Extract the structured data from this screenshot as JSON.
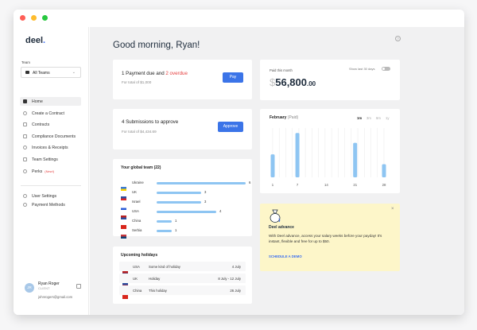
{
  "brand": {
    "logo_text": "deel",
    "logo_dot": "."
  },
  "sidebar": {
    "team_label": "Team",
    "team_value": "All Teams",
    "items": [
      {
        "label": "Home",
        "active": true
      },
      {
        "label": "Create a Contract"
      },
      {
        "label": "Contracts"
      },
      {
        "label": "Compliance Documents"
      },
      {
        "label": "Invoices & Receipts"
      },
      {
        "label": "Team Settings"
      },
      {
        "label": "Perks",
        "badge": "(New!)"
      }
    ],
    "bottom_items": [
      {
        "label": "User Settings"
      },
      {
        "label": "Payment Methods"
      }
    ],
    "user": {
      "initials": "JR",
      "name": "Ryan Roger",
      "role": "CLIENT",
      "email": "johnrogers@gmail.com"
    }
  },
  "main": {
    "greeting": "Good morning, Ryan!",
    "help": "?",
    "payment_card": {
      "title_a": "1 Payment due and ",
      "title_b": "2 overdue",
      "total": "For total of $1,000",
      "button": "Pay"
    },
    "submission_card": {
      "title": "4 Submissions to approve",
      "total": "For total of $4,434.69",
      "button": "Approve"
    },
    "team_card": {
      "title": "Your global team (22)",
      "rows": [
        {
          "country": "Ukraine",
          "count": "6",
          "value": 6
        },
        {
          "country": "UK",
          "count": "3",
          "value": 3
        },
        {
          "country": "Israel",
          "count": "3",
          "value": 3
        },
        {
          "country": "USA",
          "count": "4",
          "value": 4
        },
        {
          "country": "China",
          "count": "1",
          "value": 1
        },
        {
          "country": "Serbia",
          "count": "1",
          "value": 1
        }
      ]
    },
    "holidays_card": {
      "title": "Upcoming holidays",
      "rows": [
        {
          "country": "USA",
          "name": "Some kind of holiday",
          "date": "4 July"
        },
        {
          "country": "UK",
          "name": "Holiday",
          "date": "8 July - 12 July"
        },
        {
          "country": "China",
          "name": "This holiday",
          "date": "26 July"
        }
      ]
    },
    "paid_card": {
      "label": "Paid this month",
      "toggle_label": "Show last 30 days",
      "currency": "$",
      "amount": "56,800",
      "decimals": ".00"
    },
    "feb_card": {
      "title": "February",
      "status": "(Paid)",
      "ranges": [
        "1m",
        "3m",
        "6m",
        "1y"
      ],
      "selected_range": "1m"
    },
    "advance_card": {
      "close": "×",
      "title": "Deel advance",
      "description": "With Deel advance, access your salary weeks before your payday! It's instant, flexible and free for up to $50.",
      "link": "SCHEDULE A DEMO"
    }
  },
  "chart_data": {
    "type": "bar",
    "title": "February",
    "subtitle": "(Paid)",
    "x": [
      1,
      7,
      14,
      21,
      28
    ],
    "x_ticks": [
      "1",
      "7",
      "14",
      "21",
      "28"
    ],
    "values": [
      14,
      27,
      0,
      21,
      8
    ],
    "ylim": [
      0,
      30
    ],
    "grid": "vertical",
    "xlabel": "",
    "ylabel": ""
  }
}
